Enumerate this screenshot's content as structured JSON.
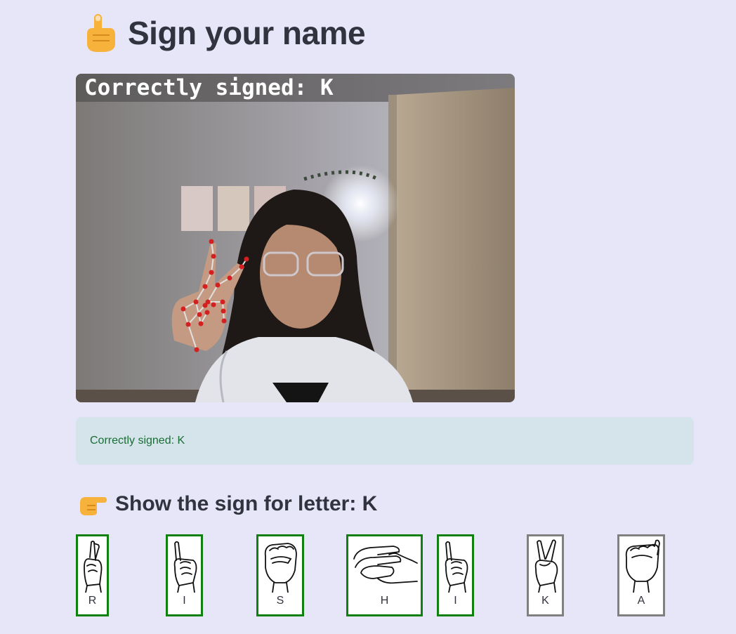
{
  "header": {
    "title": "Sign your name",
    "icon": "pointing-up-hand-icon"
  },
  "webcam": {
    "overlay_text": "Correctly signed: K"
  },
  "status": {
    "message": "Correctly signed: K",
    "color": "#1a6e35"
  },
  "prompt": {
    "text": "Show the sign for letter: K",
    "icon": "pointing-right-hand-icon"
  },
  "letters": [
    {
      "letter": "R",
      "state": "done"
    },
    {
      "letter": "I",
      "state": "done"
    },
    {
      "letter": "S",
      "state": "done"
    },
    {
      "letter": "H",
      "state": "done"
    },
    {
      "letter": "I",
      "state": "done"
    },
    {
      "letter": "K",
      "state": "current"
    },
    {
      "letter": "A",
      "state": "pending"
    }
  ],
  "colors": {
    "background": "#e6e6f8",
    "done_border": "#108010",
    "pending_border": "#808080",
    "alert_bg": "#d4e4ea"
  }
}
